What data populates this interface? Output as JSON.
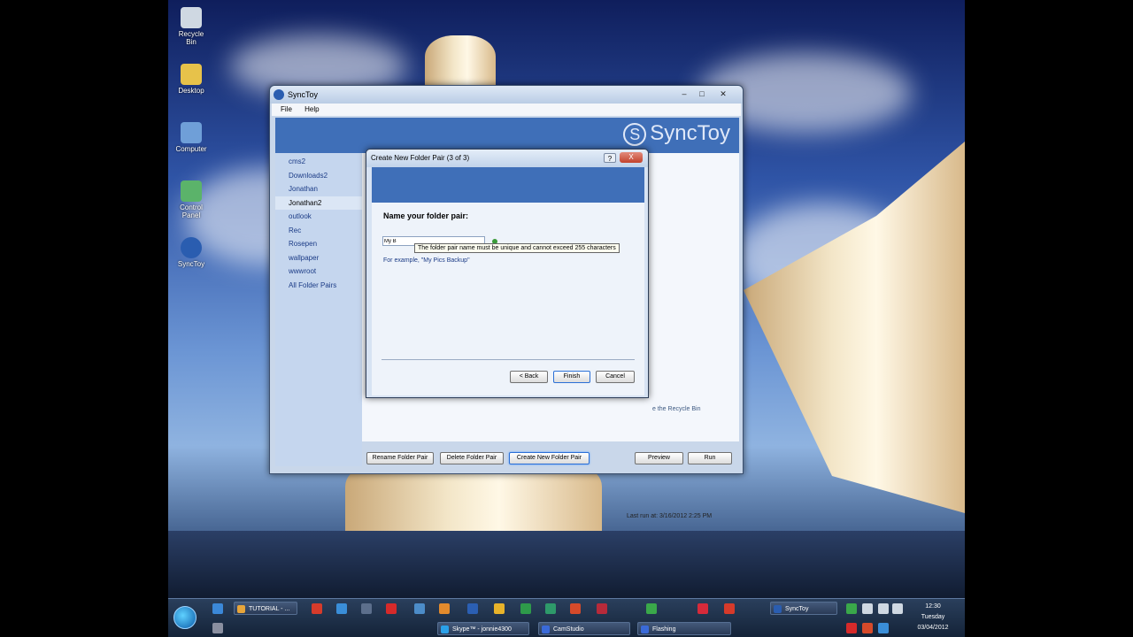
{
  "desktop": {
    "icons": [
      {
        "label": "Recycle Bin"
      },
      {
        "label": "Desktop"
      },
      {
        "label": "Computer"
      },
      {
        "label": "Control Panel"
      },
      {
        "label": "SyncToy"
      }
    ]
  },
  "synctoy": {
    "title": "SyncToy",
    "menu": [
      "File",
      "Help"
    ],
    "logo_text": "SyncToy",
    "sidebar_items": [
      "cms2",
      "Downloads2",
      "Jonathan",
      "Jonathan2",
      "outlook",
      "Rec",
      "Rosepen",
      "wallpaper",
      "wwwroot",
      "All Folder Pairs"
    ],
    "selected_item": "Jonathan2",
    "partial_text": "e the Recycle Bin",
    "last_run": "Last run at: 3/16/2012 2:25 PM",
    "buttons": {
      "rename": "Rename Folder Pair",
      "delete": "Delete Folder Pair",
      "create": "Create New Folder Pair",
      "preview": "Preview",
      "run": "Run"
    }
  },
  "dialog": {
    "title": "Create New Folder Pair (3 of 3)",
    "help": "?",
    "close": "X",
    "heading": "Name your folder pair:",
    "input_value": "My B",
    "tooltip": "The folder pair name must be unique and cannot exceed 255 characters",
    "example": "For example, \"My Pics Backup\"",
    "buttons": {
      "back": "< Back",
      "finish": "Finish",
      "cancel": "Cancel"
    }
  },
  "taskbar": {
    "tasks": {
      "tutorial": "TUTORIAL - ...",
      "synctoy": "SyncToy",
      "skype": "Skype™ - jonnie4300",
      "camstudio": "CamStudio",
      "flashing": "Flashing"
    },
    "clock": {
      "time": "12:30",
      "day": "Tuesday",
      "date": "03/04/2012"
    }
  },
  "colors": {
    "accent_blue": "#3f6fb8",
    "selected_button_border": "#2a6fd6",
    "valid_indicator": "#3a9a38"
  }
}
